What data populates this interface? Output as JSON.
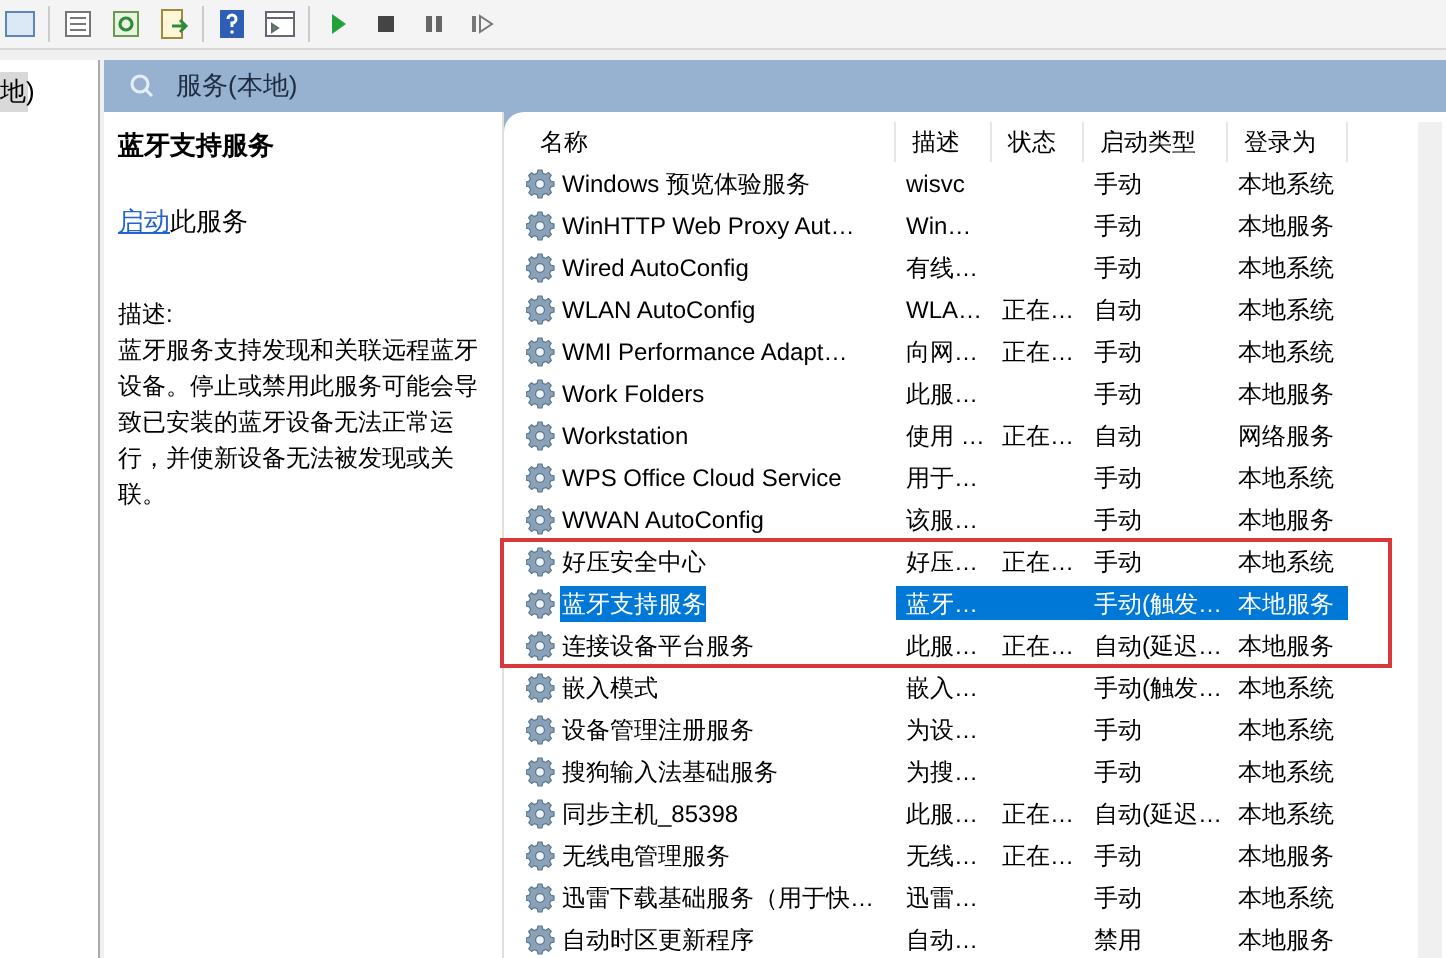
{
  "tree": {
    "item": "地)",
    "selected": true
  },
  "panel": {
    "title": "服务(本地)"
  },
  "details": {
    "service_name": "蓝牙支持服务",
    "action_link": "启动",
    "action_text": "此服务",
    "description_label": "描述:",
    "description": "蓝牙服务支持发现和关联远程蓝牙设备。停止或禁用此服务可能会导致已安装的蓝牙设备无法正常运行，并使新设备无法被发现或关联。"
  },
  "table": {
    "columns": [
      "名称",
      "描述",
      "状态",
      "启动类型",
      "登录为"
    ],
    "rows": [
      {
        "name": "Windows 预览体验服务",
        "description": "wisvc",
        "startup": "手动",
        "logon": "本地系统",
        "selected": false
      },
      {
        "name": "WinHTTP Web Proxy Aut…",
        "description": "Win…",
        "startup": "手动",
        "logon": "本地服务",
        "selected": false
      },
      {
        "name": "Wired AutoConfig",
        "description": "有线…",
        "startup": "手动",
        "logon": "本地系统",
        "selected": false
      },
      {
        "name": "WLAN AutoConfig",
        "description": "WLA…",
        "status": "正在…",
        "startup": "自动",
        "logon": "本地系统",
        "selected": false
      },
      {
        "name": "WMI Performance Adapt…",
        "description": "向网…",
        "status": "正在…",
        "startup": "手动",
        "logon": "本地系统",
        "selected": false
      },
      {
        "name": "Work Folders",
        "description": "此服…",
        "startup": "手动",
        "logon": "本地服务",
        "selected": false
      },
      {
        "name": "Workstation",
        "description": "使用 …",
        "status": "正在…",
        "startup": "自动",
        "logon": "网络服务",
        "selected": false
      },
      {
        "name": "WPS Office Cloud Service",
        "description": "用于…",
        "startup": "手动",
        "logon": "本地系统",
        "selected": false
      },
      {
        "name": "WWAN AutoConfig",
        "description": "该服…",
        "startup": "手动",
        "logon": "本地服务",
        "selected": false
      },
      {
        "name": "好压安全中心",
        "description": "好压…",
        "status": "正在…",
        "startup": "手动",
        "logon": "本地系统",
        "selected": false
      },
      {
        "name": "蓝牙支持服务",
        "description": "蓝牙…",
        "startup": "手动(触发…",
        "logon": "本地服务",
        "selected": true
      },
      {
        "name": "连接设备平台服务",
        "description": "此服…",
        "status": "正在…",
        "startup": "自动(延迟…",
        "logon": "本地服务",
        "selected": false
      },
      {
        "name": "嵌入模式",
        "description": "嵌入…",
        "startup": "手动(触发…",
        "logon": "本地系统",
        "selected": false
      },
      {
        "name": "设备管理注册服务",
        "description": "为设…",
        "startup": "手动",
        "logon": "本地系统",
        "selected": false
      },
      {
        "name": "搜狗输入法基础服务",
        "description": "为搜…",
        "startup": "手动",
        "logon": "本地系统",
        "selected": false
      },
      {
        "name": "同步主机_85398",
        "description": "此服…",
        "status": "正在…",
        "startup": "自动(延迟…",
        "logon": "本地系统",
        "selected": false
      },
      {
        "name": "无线电管理服务",
        "description": "无线…",
        "status": "正在…",
        "startup": "手动",
        "logon": "本地服务",
        "selected": false
      },
      {
        "name": "迅雷下载基础服务（用于快…",
        "description": "迅雷…",
        "startup": "手动",
        "logon": "本地系统",
        "selected": false
      },
      {
        "name": "自动时区更新程序",
        "description": "自动…",
        "startup": "禁用",
        "logon": "本地服务",
        "selected": false
      }
    ]
  }
}
